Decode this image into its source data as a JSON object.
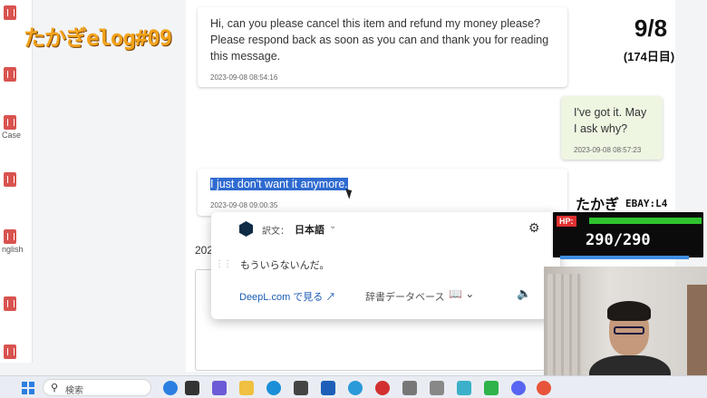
{
  "sidebar": {
    "labels": [
      "Case",
      "nglish"
    ]
  },
  "messages": [
    {
      "text": "Hi, can you please cancel this item and refund my money please? Please respond back as soon as you can and thank you for reading this message.",
      "timestamp": "2023-09-08 08:54:16"
    },
    {
      "text": "I've got it. May I ask why?",
      "timestamp": "2023-09-08 08:57:23"
    },
    {
      "text": "I just don't want it anymore.",
      "timestamp": "2023-09-08 09:00:35"
    }
  ],
  "date_stub": "202",
  "deepl": {
    "lang_label": "訳文：",
    "lang_value": "日本語",
    "translation": "もういらないんだ。",
    "link_text": "DeepL.com で見る",
    "dict_text": "辞書データベース"
  },
  "overlay": {
    "title": "たかぎelog#09",
    "day": "9/8",
    "day_sub": "(174日目)",
    "player_name": "たかぎ",
    "ebay_level": "EBAY:L4",
    "hp_label": "HP:",
    "hp_text": "290/290",
    "hp_fraction": 1.0
  },
  "taskbar": {
    "search_placeholder": "検索"
  }
}
